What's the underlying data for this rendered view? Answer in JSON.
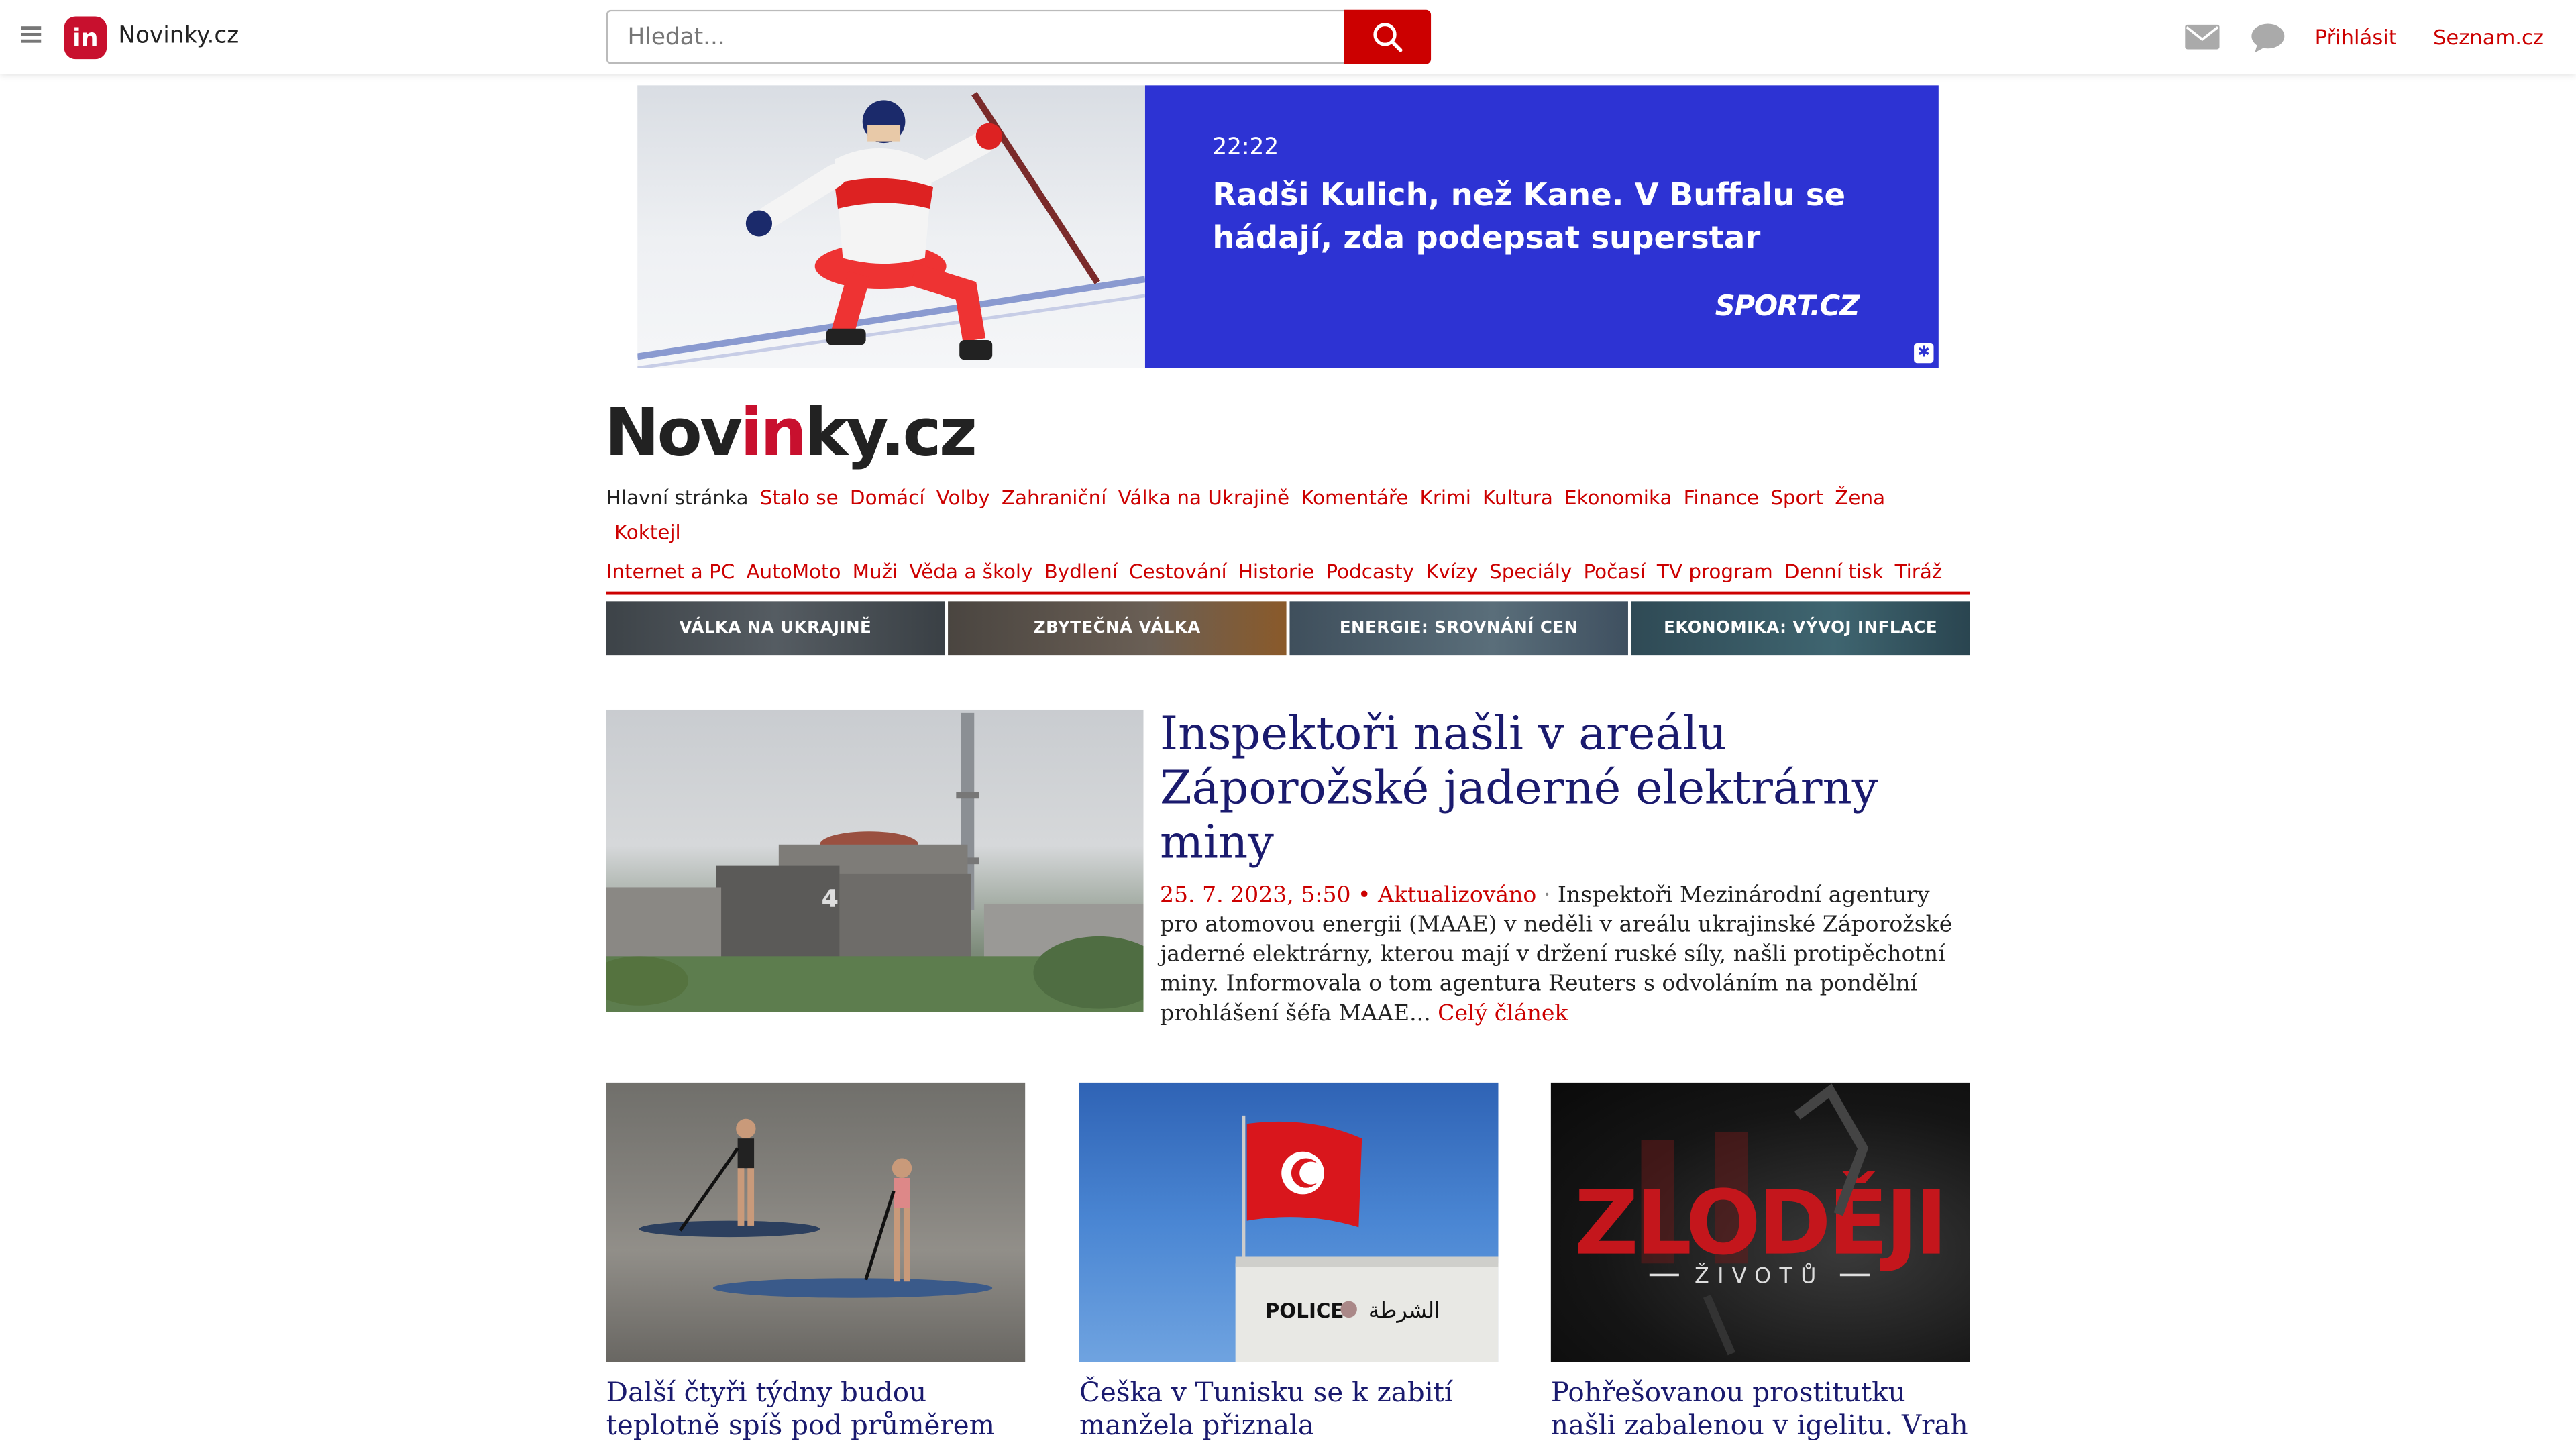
{
  "topbar": {
    "brand_badge": "in",
    "brand_name": "Novinky.cz",
    "search_placeholder": "Hledat...",
    "login": "Přihlásit",
    "seznam": "Seznam.cz"
  },
  "ad": {
    "time": "22:22",
    "headline": "Radši Kulich, než Kane. V Buffalu se hádají, zda podepsat superstar",
    "logo": "SPORT.CZ"
  },
  "logo": {
    "part1": "Nov",
    "part2": "in",
    "part3": "ky.cz"
  },
  "nav": {
    "row1": [
      "Hlavní stránka",
      "Stalo se",
      "Domácí",
      "Volby",
      "Zahraniční",
      "Válka na Ukrajině",
      "Komentáře",
      "Krimi",
      "Kultura",
      "Ekonomika",
      "Finance",
      "Sport",
      "Žena",
      "Koktejl"
    ],
    "row2": [
      "Internet a PC",
      "AutoMoto",
      "Muži",
      "Věda a školy",
      "Bydlení",
      "Cestování",
      "Historie",
      "Podcasty",
      "Kvízy",
      "Speciály",
      "Počasí",
      "TV program",
      "Denní tisk",
      "Tiráž"
    ]
  },
  "tiles": [
    "VÁLKA NA UKRAJINĚ",
    "ZBYTEČNÁ VÁLKA",
    "ENERGIE: SROVNÁNÍ CEN",
    "EKONOMIKA: VÝVOJ INFLACE"
  ],
  "lead": {
    "title": "Inspektoři našli v areálu Záporožské jaderné elektrárny miny",
    "meta": "25. 7. 2023, 5:50 • Aktualizováno",
    "text": "Inspektoři Mezinárodní agentury pro atomovou energii (MAAE) v neděli v areálu ukrajinské Záporožské jaderné elektrárny, kterou mají v držení ruské síly, našli protipěchotní miny. Informovala o tom agentura Reuters s odvoláním na pondělní prohlášení šéfa MAAE...",
    "more": "Celý článek",
    "reactor_number": "4"
  },
  "cards": [
    {
      "title": "Další čtyři týdny budou teplotně spíš pod průměrem"
    },
    {
      "title": "Češka v Tunisku se k zabití manžela přiznala",
      "sign_left": "POLICE",
      "sign_right": "الشرطة"
    },
    {
      "title": "Pohřešovanou prostitutku našli zabalenou v igelitu. Vrah",
      "overlay_main": "ZLODĚJI",
      "overlay_sub": "ŽIVOTŮ"
    }
  ],
  "colors": {
    "accent": "#c00",
    "headline": "#1a1a6e",
    "ad_blue": "#2d33d3"
  }
}
